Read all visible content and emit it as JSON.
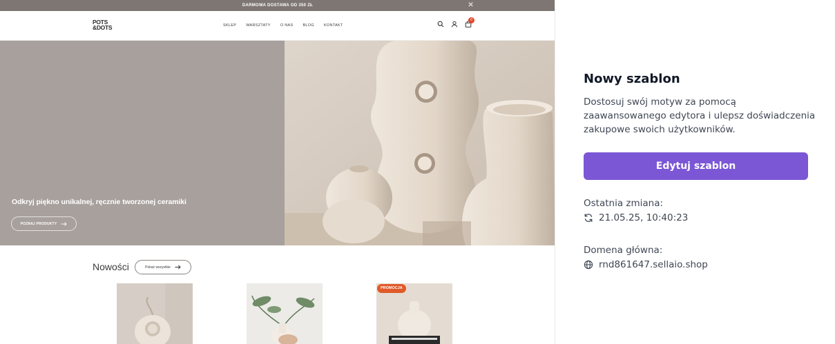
{
  "store": {
    "promo_bar": "DARMOWA DOSTAWA OD 350 ZŁ",
    "logo": "POTS &DOTS",
    "menu": [
      "SKLEP",
      "WARSZTATY",
      "O NAS",
      "BLOG",
      "KONTAKT"
    ],
    "cart_count": "0",
    "hero": {
      "headline": "Odkryj piękno unikalnej, ręcznie tworzonej ceramiki",
      "cta": "POZNAJ PRODUKTY"
    },
    "new_section": {
      "title": "Nowości",
      "show_all": "Pokaż wszystkie"
    },
    "products": [
      {
        "badge": ""
      },
      {
        "badge": ""
      },
      {
        "badge": "PROMOCJA"
      }
    ]
  },
  "panel": {
    "title": "Nowy szablon",
    "description": "Dostosuj swój motyw za pomocą zaawansowanego edytora i ulepsz doświadczenia zakupowe swoich użytkowników.",
    "edit_button": "Edytuj szablon",
    "last_change_label": "Ostatnia zmiana:",
    "last_change_value": "21.05.25, 10:40:23",
    "domain_label": "Domena główna:",
    "domain_value": "rnd861647.sellaio.shop",
    "accent_color": "#7b57d6"
  }
}
